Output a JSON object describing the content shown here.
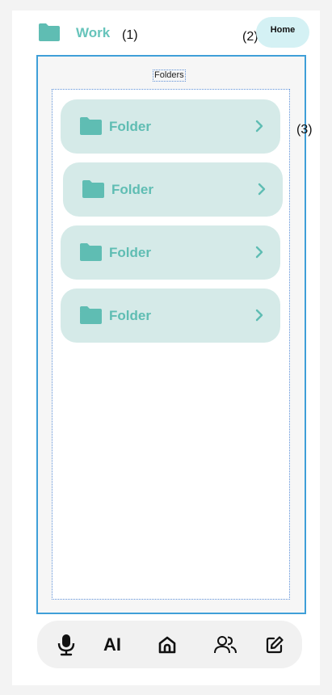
{
  "header": {
    "title": "Work",
    "home_label": "Home"
  },
  "annotations": {
    "a1": "(1)",
    "a2": "(2)",
    "a3": "(3)"
  },
  "main": {
    "section_label": "Folders",
    "folders": [
      {
        "label": "Folder"
      },
      {
        "label": "Folder"
      },
      {
        "label": "Folder"
      },
      {
        "label": "Folder"
      }
    ]
  },
  "bottom_nav": {
    "items": [
      {
        "icon": "microphone-icon"
      },
      {
        "label": "AI"
      },
      {
        "icon": "home-icon"
      },
      {
        "icon": "users-icon"
      },
      {
        "icon": "edit-icon"
      }
    ]
  },
  "colors": {
    "accent": "#67c4bb",
    "card": "#d5eae8",
    "home_pill": "#d4f1f4",
    "frame_border": "#3f9fd8"
  }
}
